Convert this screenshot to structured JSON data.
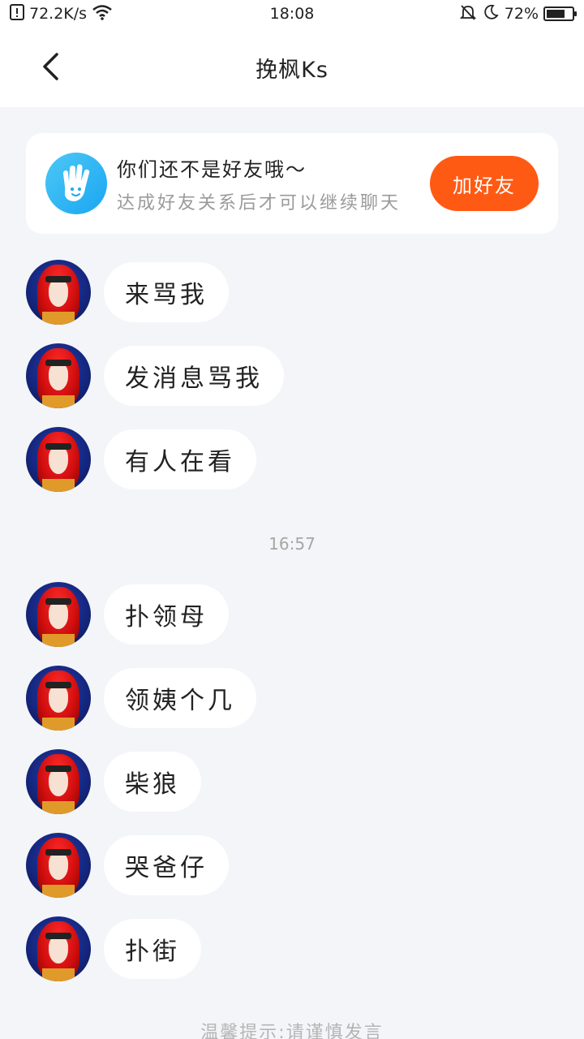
{
  "status_bar": {
    "net_speed": "72.2K/s",
    "time": "18:08",
    "battery_percent": "72%",
    "battery_level": 0.72,
    "icons": [
      "sim-alert-icon",
      "wifi-icon",
      "bell-mute-icon",
      "moon-icon",
      "battery-icon"
    ]
  },
  "header": {
    "title": "挽枫Ks",
    "back_icon": "chevron-left-icon"
  },
  "friend_banner": {
    "icon": "hand-icon",
    "title": "你们还不是好友哦～",
    "subtitle": "达成好友关系后才可以继续聊天",
    "button_label": "加好友",
    "button_color": "#ff5a14"
  },
  "messages_group1": [
    {
      "text": "来骂我"
    },
    {
      "text": "发消息骂我"
    },
    {
      "text": "有人在看"
    }
  ],
  "timestamp": "16:57",
  "messages_group2": [
    {
      "text": "扑领母"
    },
    {
      "text": "领姨个几"
    },
    {
      "text": "柴狼"
    },
    {
      "text": "哭爸仔"
    },
    {
      "text": "扑街"
    }
  ],
  "footer_tip": "温馨提示:请谨慎发言",
  "colors": {
    "background": "#f3f5f8",
    "accent": "#ff5a14",
    "hand_icon": "#1aa6f2"
  }
}
